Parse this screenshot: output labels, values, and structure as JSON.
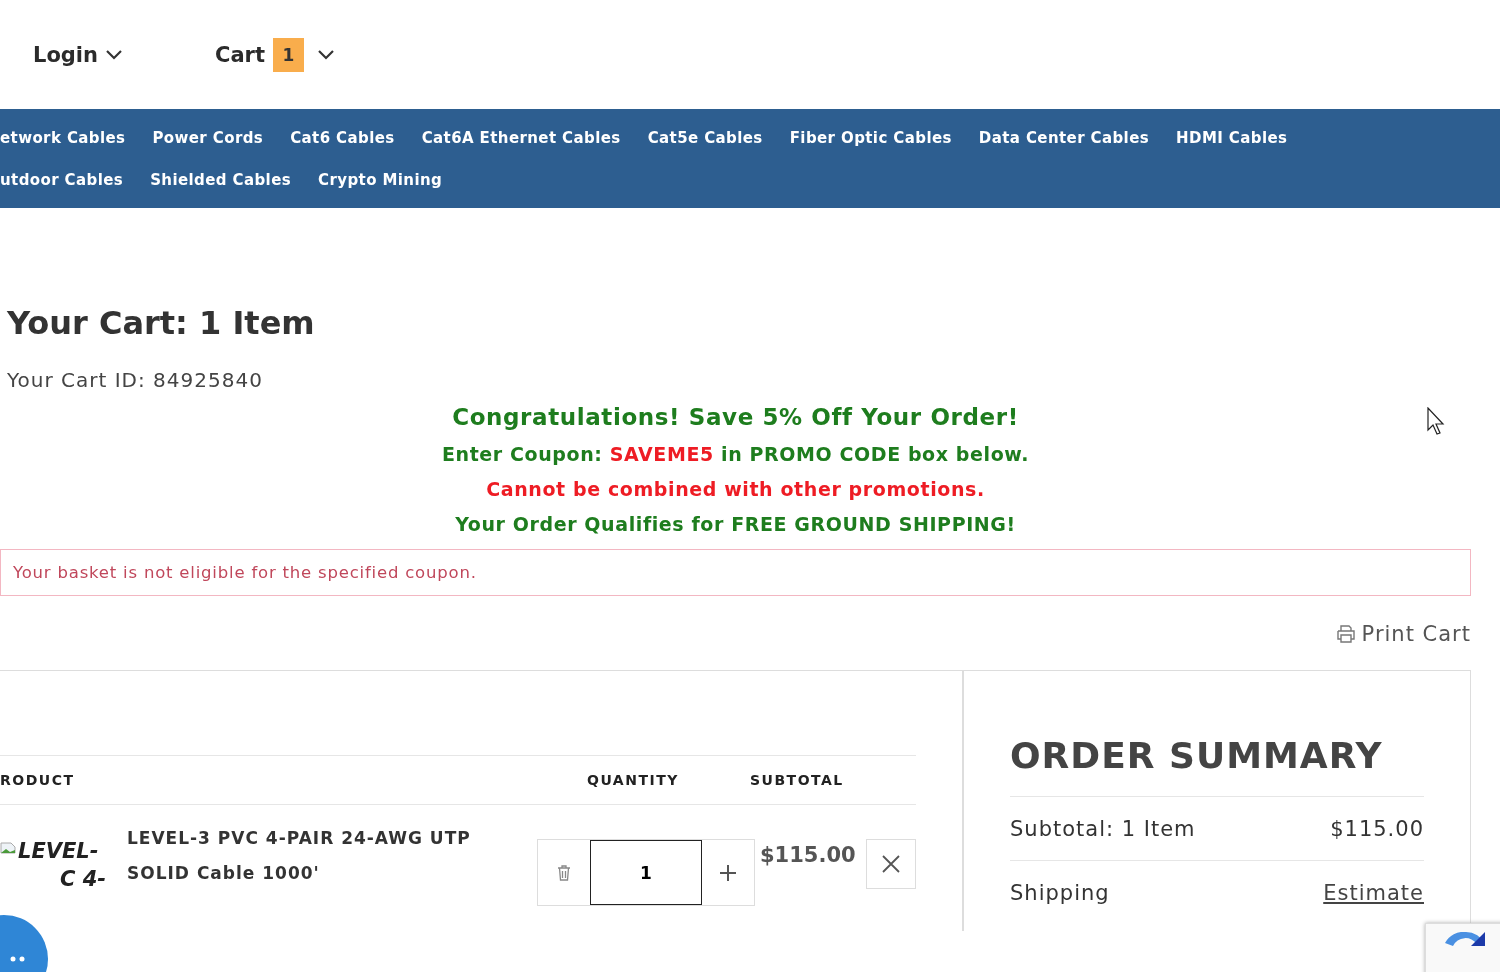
{
  "header": {
    "login": "Login",
    "cart": {
      "label": "Cart",
      "count": "1"
    }
  },
  "nav": {
    "rows": [
      [
        "etwork Cables",
        "Power Cords",
        "Cat6 Cables",
        "Cat6A Ethernet Cables",
        "Cat5e Cables",
        "Fiber Optic Cables",
        "Data Center Cables",
        "HDMI Cables"
      ],
      [
        "utdoor Cables",
        "Shielded Cables",
        "Crypto Mining"
      ]
    ]
  },
  "title": "Your Cart: 1 Item",
  "cart_id": "Your Cart ID: 84925840",
  "promo": [
    {
      "kind": "headline",
      "segments": [
        {
          "text": "Congratulations! Save 5% Off Your Order!",
          "color": "#1e7d1e"
        }
      ]
    },
    {
      "kind": "note",
      "segments": [
        {
          "text": "Enter Coupon: ",
          "color": "#1e7d1e"
        },
        {
          "text": "SAVEME5",
          "color": "#ee1c24"
        },
        {
          "text": " in PROMO CODE box below.",
          "color": "#1e7d1e"
        }
      ]
    },
    {
      "kind": "note",
      "segments": [
        {
          "text": "Cannot be combined with other promotions.",
          "color": "#ee1c24"
        }
      ]
    },
    {
      "kind": "note",
      "segments": [
        {
          "text": "Your Order Qualifies for FREE GROUND SHIPPING!",
          "color": "#1e7d1e"
        }
      ]
    }
  ],
  "alert": "Your basket is not eligible for the specified coupon.",
  "print_cart": "Print Cart",
  "table": {
    "columns": [
      "RODUCT",
      "QUANTITY",
      "SUBTOTAL"
    ],
    "rows": [
      {
        "image_alt": [
          "LEVEL-",
          "C 4-"
        ],
        "name": "LEVEL-3 PVC 4-PAIR 24-AWG UTP SOLID Cable 1000'",
        "quantity": "1",
        "subtotal": "$115.00"
      }
    ]
  },
  "summary": {
    "title": "ORDER SUMMARY",
    "subtotal_label": "Subtotal: 1 Item",
    "subtotal_value": "$115.00",
    "shipping_label": "Shipping",
    "shipping_link": "Estimate"
  }
}
